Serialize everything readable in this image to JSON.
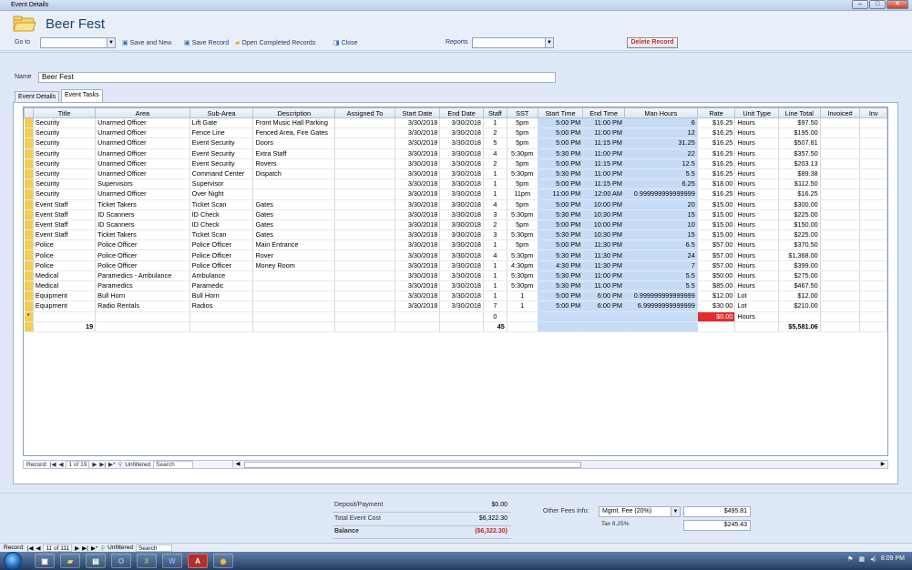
{
  "window": {
    "title": "Event Details"
  },
  "header": {
    "title": "Beer Fest"
  },
  "toolbar": {
    "goto_label": "Go to",
    "save_new": "Save and New",
    "save_record": "Save Record",
    "open_completed": "Open Completed Records",
    "close": "Close",
    "reports_label": "Reports",
    "delete_record": "Delete Record"
  },
  "form": {
    "name_label": "Name",
    "name_value": "Beer Fest"
  },
  "tabs": [
    {
      "label": "Event Details"
    },
    {
      "label": "Event Tasks"
    }
  ],
  "grid": {
    "columns": [
      "Title",
      "Area",
      "Sub-Area",
      "Description",
      "Assigned To",
      "Start Date",
      "End Date",
      "Staff",
      "SST",
      "Start Time",
      "End Time",
      "Man Hours",
      "Rate",
      "Unit Type",
      "Line Total",
      "Invoice#",
      "Inv"
    ],
    "rows": [
      [
        "Security",
        "Unarmed Officer",
        "Lift Gate",
        "Front Music Hall Parking",
        "",
        "3/30/2018",
        "3/30/2018",
        "1",
        "5pm",
        "5:00 PM",
        "11:00 PM",
        "6",
        "$16.25",
        "Hours",
        "$97.50",
        "",
        ""
      ],
      [
        "Security",
        "Unarmed Officer",
        "Fence Line",
        "Fenced Area, Fire Gates",
        "",
        "3/30/2018",
        "3/30/2018",
        "2",
        "5pm",
        "5:00 PM",
        "11:00 PM",
        "12",
        "$16.25",
        "Hours",
        "$195.00",
        "",
        ""
      ],
      [
        "Security",
        "Unarmed Officer",
        "Event Security",
        "Doors",
        "",
        "3/30/2018",
        "3/30/2018",
        "5",
        "5pm",
        "5:00 PM",
        "11:15 PM",
        "31.25",
        "$16.25",
        "Hours",
        "$507.81",
        "",
        ""
      ],
      [
        "Security",
        "Unarmed Officer",
        "Event Security",
        "Extra Staff",
        "",
        "3/30/2018",
        "3/30/2018",
        "4",
        "5:30pm",
        "5:30 PM",
        "11:00 PM",
        "22",
        "$16.25",
        "Hours",
        "$357.50",
        "",
        ""
      ],
      [
        "Security",
        "Unarmed Officer",
        "Event Security",
        "Rovers",
        "",
        "3/30/2018",
        "3/30/2018",
        "2",
        "5pm",
        "5:00 PM",
        "11:15 PM",
        "12.5",
        "$16.25",
        "Hours",
        "$203.13",
        "",
        ""
      ],
      [
        "Security",
        "Unarmed Officer",
        "Command Center",
        "Dispatch",
        "",
        "3/30/2018",
        "3/30/2018",
        "1",
        "5:30pm",
        "5:30 PM",
        "11:00 PM",
        "5.5",
        "$16.25",
        "Hours",
        "$89.38",
        "",
        ""
      ],
      [
        "Security",
        "Supervisors",
        "Supervisor",
        "",
        "",
        "3/30/2018",
        "3/30/2018",
        "1",
        "5pm",
        "5:00 PM",
        "11:15 PM",
        "6.25",
        "$18.00",
        "Hours",
        "$112.50",
        "",
        ""
      ],
      [
        "Security",
        "Unarmed Officer",
        "Over Night",
        "",
        "",
        "3/30/2018",
        "3/30/2018",
        "1",
        "11pm",
        "11:00 PM",
        "12:00 AM",
        "0.999999999999999",
        "$16.25",
        "Hours",
        "$16.25",
        "",
        ""
      ],
      [
        "Event Staff",
        "Ticket Takers",
        "Ticket Scan",
        "Gates",
        "",
        "3/30/2018",
        "3/30/2018",
        "4",
        "5pm",
        "5:00 PM",
        "10:00 PM",
        "20",
        "$15.00",
        "Hours",
        "$300.00",
        "",
        ""
      ],
      [
        "Event Staff",
        "ID Scanners",
        "ID Check",
        "Gates",
        "",
        "3/30/2018",
        "3/30/2018",
        "3",
        "5:30pm",
        "5:30 PM",
        "10:30 PM",
        "15",
        "$15.00",
        "Hours",
        "$225.00",
        "",
        ""
      ],
      [
        "Event Staff",
        "ID Scanners",
        "ID Check",
        "Gates",
        "",
        "3/30/2018",
        "3/30/2018",
        "2",
        "5pm",
        "5:00 PM",
        "10:00 PM",
        "10",
        "$15.00",
        "Hours",
        "$150.00",
        "",
        ""
      ],
      [
        "Event Staff",
        "Ticket Takers",
        "Ticket Scan",
        "Gates",
        "",
        "3/30/2018",
        "3/30/2018",
        "3",
        "5:30pm",
        "5:30 PM",
        "10:30 PM",
        "15",
        "$15.00",
        "Hours",
        "$225.00",
        "",
        ""
      ],
      [
        "Police",
        "Police Officer",
        "Police Officer",
        "Main Entrance",
        "",
        "3/30/2018",
        "3/30/2018",
        "1",
        "5pm",
        "5:00 PM",
        "11:30 PM",
        "6.5",
        "$57.00",
        "Hours",
        "$370.50",
        "",
        ""
      ],
      [
        "Police",
        "Police Officer",
        "Police Officer",
        "Rover",
        "",
        "3/30/2018",
        "3/30/2018",
        "4",
        "5:30pm",
        "5:30 PM",
        "11:30 PM",
        "24",
        "$57.00",
        "Hours",
        "$1,368.00",
        "",
        ""
      ],
      [
        "Police",
        "Police Officer",
        "Police Officer",
        "Money Room",
        "",
        "3/30/2018",
        "3/30/2018",
        "1",
        "4:30pm",
        "4:30 PM",
        "11:30 PM",
        "7",
        "$57.00",
        "Hours",
        "$399.00",
        "",
        ""
      ],
      [
        "Medical",
        "Paramedics - Ambulance",
        "Ambulance",
        "",
        "",
        "3/30/2018",
        "3/30/2018",
        "1",
        "5:30pm",
        "5:30 PM",
        "11:00 PM",
        "5.5",
        "$50.00",
        "Hours",
        "$275.00",
        "",
        ""
      ],
      [
        "Medical",
        "Paramedics",
        "Paramedic",
        "",
        "",
        "3/30/2018",
        "3/30/2018",
        "1",
        "5:30pm",
        "5:30 PM",
        "11:00 PM",
        "5.5",
        "$85.00",
        "Hours",
        "$467.50",
        "",
        ""
      ],
      [
        "Equipment",
        "Bull Horn",
        "Bull Horn",
        "",
        "",
        "3/30/2018",
        "3/30/2018",
        "1",
        "1",
        "5:00 PM",
        "6:00 PM",
        "0.999999999999999",
        "$12.00",
        "Lot",
        "$12.00",
        "",
        ""
      ],
      [
        "Equipment",
        "Radio Rentals",
        "Radios",
        "",
        "",
        "3/30/2018",
        "3/30/2018",
        "7",
        "1",
        "5:00 PM",
        "6:00 PM",
        "6.99999999999999",
        "$30.00",
        "Lot",
        "$210.00",
        "",
        ""
      ]
    ],
    "new_row": {
      "marker": "*",
      "staff": "0",
      "rate": "$0.00",
      "unit": "Hours"
    },
    "totals": {
      "title": "19",
      "staff": "45",
      "line_total": "$5,581.06"
    }
  },
  "subform_nav": {
    "record_label": "Record:",
    "position": "1 of 19",
    "filter": "Unfiltered",
    "search": "Search"
  },
  "summary": {
    "deposit_label": "Deposit/Payment",
    "deposit_value": "$0.00",
    "total_label": "Total Event Cost",
    "total_value": "$6,322.30",
    "balance_label": "Balance",
    "balance_value": "($6,322.30)",
    "other_fees_label": "Other Fees Info:",
    "fee_type": "Mgmt. Fee (20%)",
    "fee_value": "$495.81",
    "tax_label": "Tax 8.25%",
    "tax_value": "$245.43"
  },
  "form_nav": {
    "record_label": "Record:",
    "position": "11 of 111",
    "filter": "Unfiltered",
    "search": "Search"
  },
  "taskbar": {
    "clock": "8:09 PM"
  },
  "colors": {
    "accent": "#1e3e6b",
    "selector": "#f2cd52",
    "highlight": "#c6dcf6",
    "alert": "#e12d2d",
    "balance": "#c0282c"
  }
}
